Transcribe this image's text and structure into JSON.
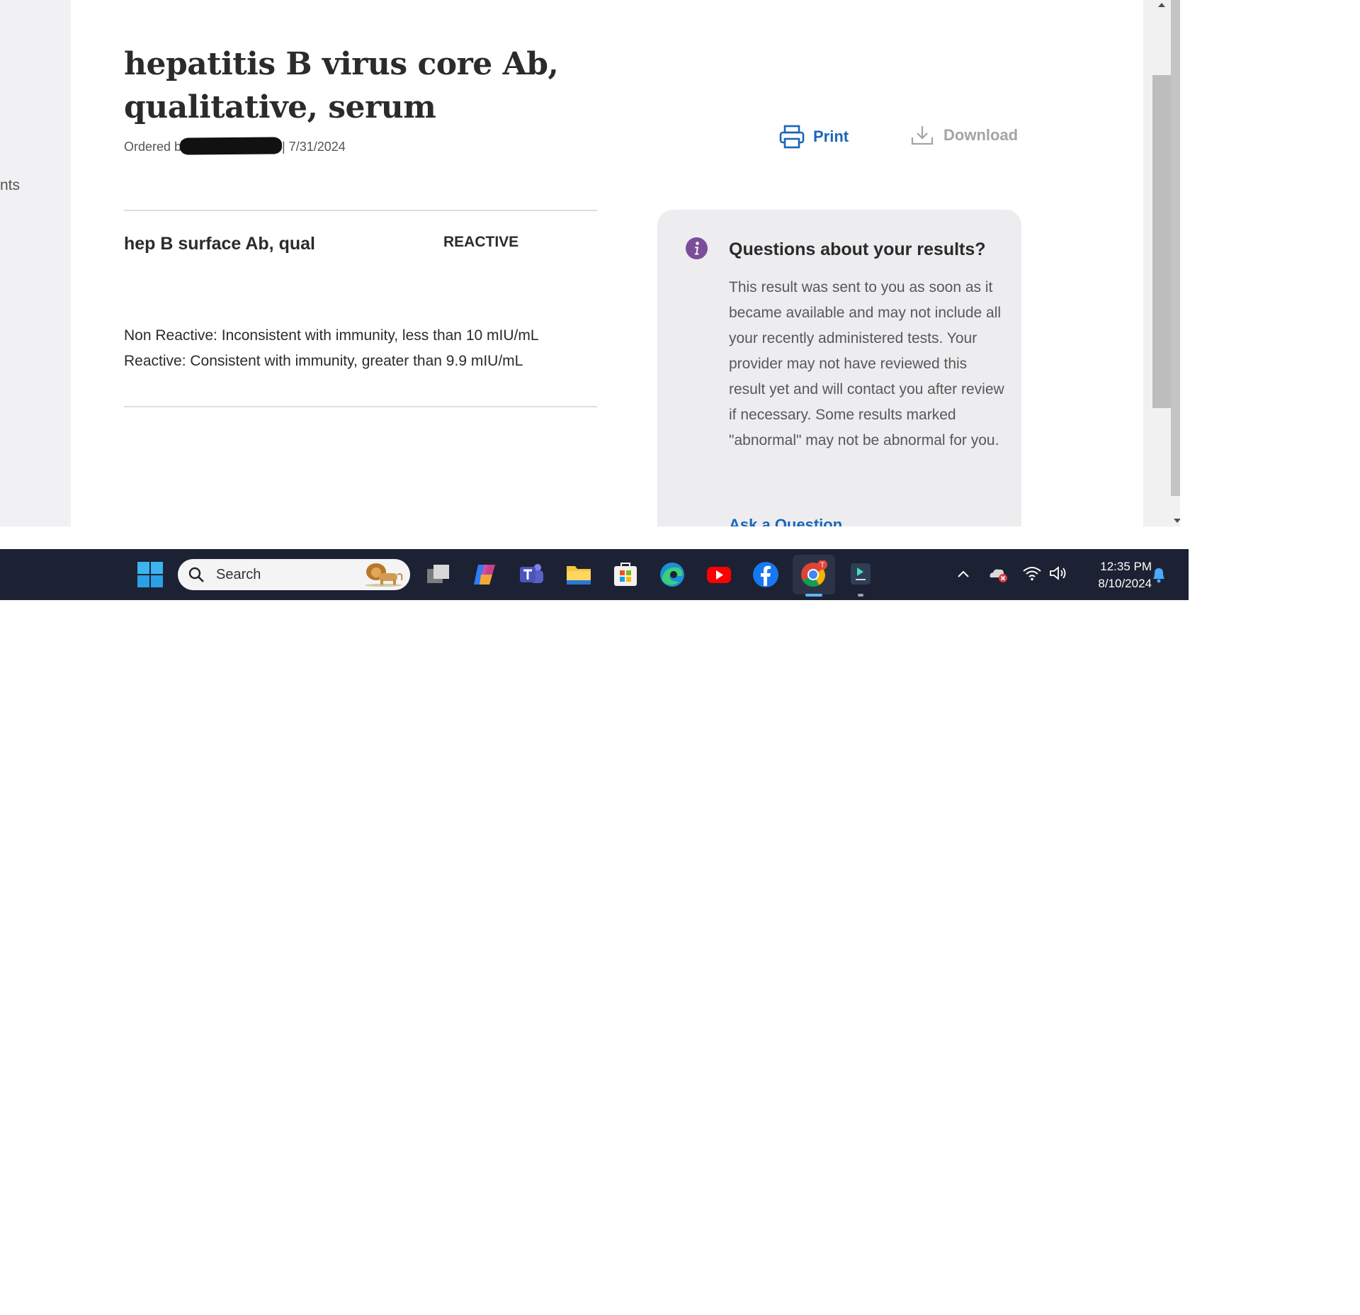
{
  "page": {
    "left_nav_fragment": "nts",
    "title": "hepatitis B virus core Ab, qualitative, serum",
    "ordered_prefix": "Ordered b",
    "ordered_date": "| 7/31/2024",
    "actions": {
      "print_label": "Print",
      "download_label": "Download"
    },
    "result": {
      "component_name": "hep B surface Ab, qual",
      "component_value": "REACTIVE",
      "reference_line_1": "Non Reactive: Inconsistent with immunity, less than 10 mIU/mL",
      "reference_line_2": "Reactive: Consistent with immunity, greater than 9.9 mIU/mL"
    },
    "questions_card": {
      "heading": "Questions about your results?",
      "body": "This result was sent to you as soon as it became available and may not include all your recently administered tests. Your provider may not have reviewed this result yet and will contact you after review if necessary. Some results marked \"abnormal\" may not be abnormal for you.",
      "ask_link": "Ask a Question"
    }
  },
  "taskbar": {
    "search_label": "Search",
    "apps": [
      "start",
      "task-view",
      "copilot",
      "teams",
      "file-explorer",
      "microsoft-store",
      "edge",
      "youtube",
      "facebook",
      "chrome",
      "remote-app"
    ],
    "chrome_badge": "T",
    "time": "12:35 PM",
    "date": "8/10/2024"
  },
  "colors": {
    "accent_link": "#1a66b8",
    "info_icon": "#7b4e9a",
    "card_bg": "#ededf0",
    "taskbar_bg": "#1c2233"
  }
}
